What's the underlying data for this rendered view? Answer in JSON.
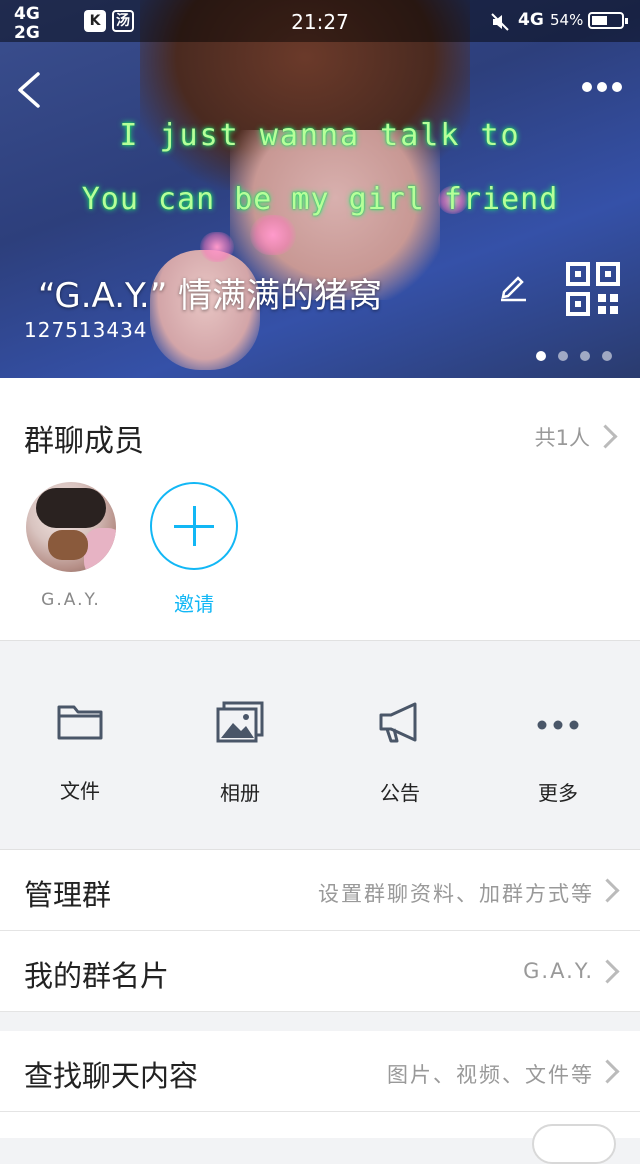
{
  "status_bar": {
    "net1": "4G",
    "net2": "2G",
    "app_icon_1": "K",
    "app_icon_2": "汤",
    "time": "21:27",
    "right_net": "4G",
    "battery_text": "54%",
    "battery_level": 0.54
  },
  "header": {
    "lyric_line1": "I just wanna talk to",
    "lyric_line2": "You can be my girl friend",
    "group_name": "“G.A.Y.” 情满满的猪窝",
    "group_number": "127513434",
    "page_count": 4,
    "active_page": 1,
    "icons": [
      "back-icon",
      "more-icon",
      "edit-icon",
      "qr-code-icon"
    ]
  },
  "members": {
    "title": "群聊成员",
    "count": "共1人",
    "list": [
      {
        "name": "G.A.Y."
      }
    ],
    "invite_label": "邀请"
  },
  "tools": [
    {
      "label": "文件",
      "icon": "folder-icon"
    },
    {
      "label": "相册",
      "icon": "album-icon"
    },
    {
      "label": "公告",
      "icon": "announcement-icon"
    },
    {
      "label": "更多",
      "icon": "more-dots-icon"
    }
  ],
  "settings": [
    {
      "label": "管理群",
      "value": "设置群聊资料、加群方式等"
    },
    {
      "label": "我的群名片",
      "value": "G.A.Y."
    },
    {
      "label": "查找聊天内容",
      "value": "图片、视频、文件等"
    }
  ],
  "colors": {
    "accent": "#12b7f5",
    "lyric": "#b6ff9a",
    "background": "#f2f3f5"
  }
}
